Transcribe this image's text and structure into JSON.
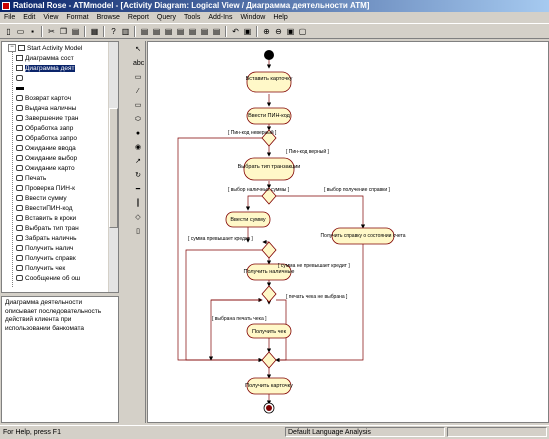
{
  "window": {
    "title": "Rational Rose - ATMmodel - [Activity Diagram: Logical View / Диаграмма деятельности ATM]"
  },
  "menu": [
    "File",
    "Edit",
    "View",
    "Format",
    "Browse",
    "Report",
    "Query",
    "Tools",
    "Add-Ins",
    "Window",
    "Help"
  ],
  "browser": {
    "root": "Start Activity Model",
    "items": [
      {
        "label": "Диаграмма сост",
        "icon": "diagram-icon"
      },
      {
        "label": "Диаграмма деят",
        "icon": "diagram-icon",
        "selected": true
      },
      {
        "label": "",
        "icon": "state-icon"
      },
      {
        "label": "",
        "icon": "transition-icon"
      },
      {
        "label": "Возврат карточ",
        "icon": "activity-icon"
      },
      {
        "label": "Выдача наличны",
        "icon": "activity-icon"
      },
      {
        "label": "Завершение тран",
        "icon": "activity-icon"
      },
      {
        "label": "Обработка запр",
        "icon": "activity-icon"
      },
      {
        "label": "Обработка запро",
        "icon": "activity-icon"
      },
      {
        "label": "Ожидание ввода",
        "icon": "activity-icon"
      },
      {
        "label": "Ожидание выбор",
        "icon": "activity-icon"
      },
      {
        "label": "Ожидание карто",
        "icon": "activity-icon"
      },
      {
        "label": "Печать",
        "icon": "activity-icon"
      },
      {
        "label": "Проверка ПИН-к",
        "icon": "activity-icon"
      },
      {
        "label": "Ввести сумму",
        "icon": "activity-icon"
      },
      {
        "label": "ВвестиПИН-код",
        "icon": "activity-icon"
      },
      {
        "label": "Вставить в кроки",
        "icon": "activity-icon"
      },
      {
        "label": "Выбрать тип тран",
        "icon": "activity-icon"
      },
      {
        "label": "Забрать наличнь",
        "icon": "activity-icon"
      },
      {
        "label": "Получить налич",
        "icon": "activity-icon"
      },
      {
        "label": "Получить справк",
        "icon": "activity-icon"
      },
      {
        "label": "Получить чек",
        "icon": "activity-icon"
      },
      {
        "label": "Сообщение об ош",
        "icon": "activity-icon"
      }
    ]
  },
  "documentation": "Диаграмма деятельности описывает последовательность действий клиента при использовании банкомата",
  "diagram": {
    "activities": {
      "insert_card": "Вставить карточку",
      "enter_pin": "Ввести ПИН-код",
      "choose_transaction": "Выбрать тип транзакции",
      "enter_amount": "Ввести сумму",
      "get_certificate": "Получить справку о состоянии счета",
      "get_cash": "Получить наличные",
      "get_receipt": "Получить чек",
      "get_card_back": "Получить карточку"
    },
    "guards": {
      "pin_wrong": "[ Пин-код неверный ]",
      "pin_right": "[ Пин-код верный ]",
      "choose_cash": "[ выбор наличных суммы ]",
      "choose_info": "[ выбор получение справки ]",
      "over_limit": "[ сумма превышает кредит ]",
      "within_limit": "[ сумма не превышает кредит ]",
      "receipt_chosen": "[ выбрана печать чека ]",
      "receipt_not": "[ печать чека не выбрана ]"
    }
  },
  "status": {
    "help": "For Help, press F1",
    "language": "Default Language Analysis"
  }
}
